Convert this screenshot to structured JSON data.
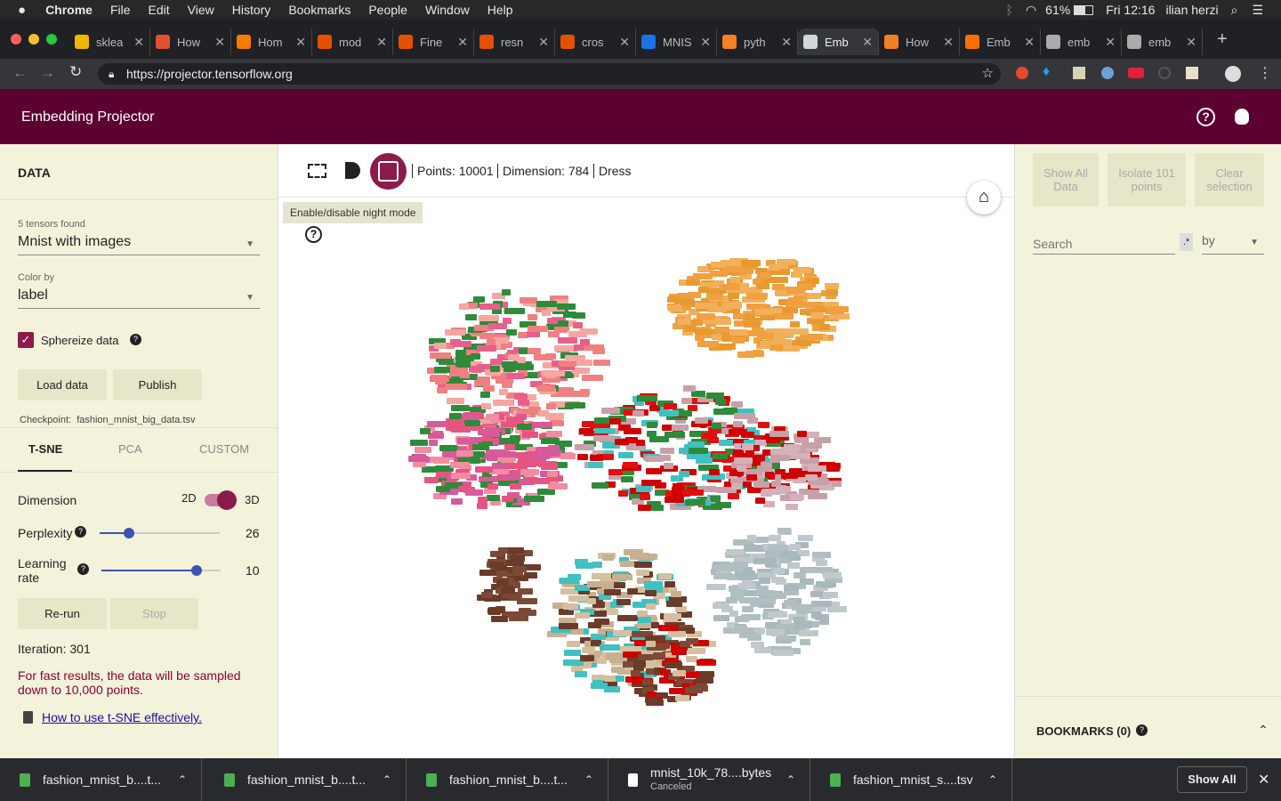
{
  "menubar": {
    "app": "Chrome",
    "items": [
      "File",
      "Edit",
      "View",
      "History",
      "Bookmarks",
      "People",
      "Window",
      "Help"
    ],
    "battery": "61%",
    "clock": "Fri 12:16",
    "user": "ilian herzi"
  },
  "tabs": [
    {
      "label": "sklea",
      "color": "#f4b400"
    },
    {
      "label": "How",
      "color": "#e2512f"
    },
    {
      "label": "Hom",
      "color": "#f57c00"
    },
    {
      "label": "mod",
      "color": "#e65100"
    },
    {
      "label": "Fine",
      "color": "#e65100"
    },
    {
      "label": "resn",
      "color": "#e65100"
    },
    {
      "label": "cros",
      "color": "#e65100"
    },
    {
      "label": "MNIS",
      "color": "#1a73e8"
    },
    {
      "label": "pyth",
      "color": "#f48024"
    },
    {
      "label": "Emb",
      "color": "#cfd8dc"
    },
    {
      "label": "How",
      "color": "#f48024"
    },
    {
      "label": "Emb",
      "color": "#ff6f00"
    },
    {
      "label": "emb",
      "color": "#aaaaaa"
    },
    {
      "label": "emb",
      "color": "#aaaaaa"
    }
  ],
  "browser": {
    "url": "https://projector.tensorflow.org"
  },
  "app": {
    "title": "Embedding Projector"
  },
  "left": {
    "data_heading": "DATA",
    "tensors_label": "5 tensors found",
    "tensor_value": "Mnist with images",
    "colorby_label": "Color by",
    "colorby_value": "label",
    "sphereize": "Sphereize data",
    "load": "Load data",
    "publish": "Publish",
    "checkpoint": "Checkpoint:  fashion_mnist_big_data.tsv",
    "tab_tsne": "T-SNE",
    "tab_pca": "PCA",
    "tab_custom": "CUSTOM",
    "dimension": "Dimension",
    "dim2": "2D",
    "dim3": "3D",
    "dim_value": 1,
    "perplexity": "Perplexity",
    "perplexity_value": "26",
    "perplexity_frac": 0.25,
    "learning": "Learning",
    "rate": "rate",
    "learning_value": "10",
    "learning_frac": 0.8,
    "rerun": "Re-run",
    "stop": "Stop",
    "iteration": "Iteration: 301",
    "warn": "For fast results, the data will be sampled down to 10,000 points.",
    "howto": "How to use t-SNE effectively."
  },
  "main": {
    "points": "Points: 10001",
    "dimension": "Dimension: 784",
    "selected": "Dress",
    "tooltip": "Enable/disable night mode"
  },
  "right": {
    "show_all": "Show All Data",
    "isolate": "Isolate 101 points",
    "clear": "Clear selection",
    "search_placeholder": "Search",
    "regex": ".*",
    "by": "by",
    "bookmarks": "BOOKMARKS (0)"
  },
  "downloads": {
    "items": [
      {
        "name": "fashion_mnist_b....t...",
        "sub": ""
      },
      {
        "name": "fashion_mnist_b....t...",
        "sub": ""
      },
      {
        "name": "fashion_mnist_b....t...",
        "sub": ""
      },
      {
        "name": "mnist_10k_78....bytes",
        "sub": "Canceled"
      },
      {
        "name": "fashion_mnist_s....tsv",
        "sub": ""
      }
    ],
    "show_all": "Show All"
  },
  "colors": {
    "header": "#5c0032",
    "panel": "#f3f3dc",
    "accent": "#8c1b4a"
  }
}
